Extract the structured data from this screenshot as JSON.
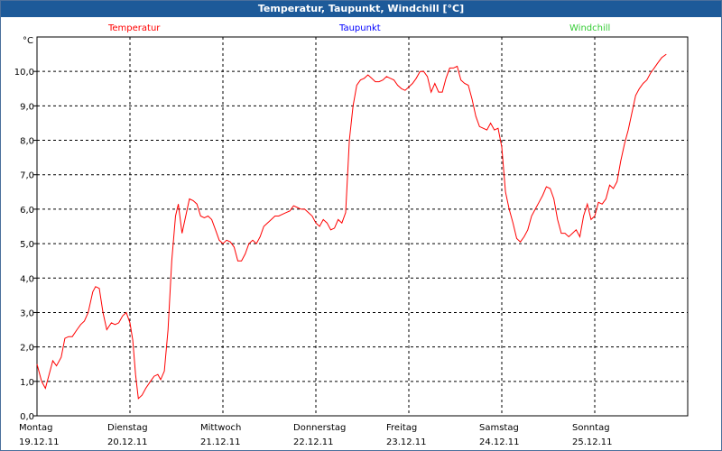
{
  "window": {
    "title": "Temperatur, Taupunkt, Windchill [°C]"
  },
  "legend": [
    {
      "name": "Temperatur",
      "color": "#ff0000"
    },
    {
      "name": "Taupunkt",
      "color": "#0000ff"
    },
    {
      "name": "Windchill",
      "color": "#33cc33"
    }
  ],
  "chart_data": {
    "type": "line",
    "title": "Temperatur, Taupunkt, Windchill [°C]",
    "ylabel": "°C",
    "ylim": [
      0,
      11
    ],
    "xlim": [
      0,
      7
    ],
    "grid": true,
    "legend_position": "top",
    "y_ticks": [
      {
        "value": 0,
        "label": "0,0"
      },
      {
        "value": 1,
        "label": "1,0"
      },
      {
        "value": 2,
        "label": "2,0"
      },
      {
        "value": 3,
        "label": "3,0"
      },
      {
        "value": 4,
        "label": "4,0"
      },
      {
        "value": 5,
        "label": "5,0"
      },
      {
        "value": 6,
        "label": "6,0"
      },
      {
        "value": 7,
        "label": "7,0"
      },
      {
        "value": 8,
        "label": "8,0"
      },
      {
        "value": 9,
        "label": "9,0"
      },
      {
        "value": 10,
        "label": "10,0"
      }
    ],
    "x_ticks": [
      {
        "value": 0,
        "day": "Montag",
        "date": "19.12.11"
      },
      {
        "value": 1,
        "day": "Dienstag",
        "date": "20.12.11"
      },
      {
        "value": 2,
        "day": "Mittwoch",
        "date": "21.12.11"
      },
      {
        "value": 3,
        "day": "Donnerstag",
        "date": "22.12.11"
      },
      {
        "value": 4,
        "day": "Freitag",
        "date": "23.12.11"
      },
      {
        "value": 5,
        "day": "Samstag",
        "date": "24.12.11"
      },
      {
        "value": 6,
        "day": "Sonntag",
        "date": "25.12.11"
      }
    ],
    "series": [
      {
        "name": "Temperatur",
        "color": "#ff0000",
        "points": [
          [
            0.0,
            1.5
          ],
          [
            0.05,
            1.0
          ],
          [
            0.09,
            0.8
          ],
          [
            0.13,
            1.2
          ],
          [
            0.17,
            1.6
          ],
          [
            0.21,
            1.45
          ],
          [
            0.26,
            1.7
          ],
          [
            0.3,
            2.25
          ],
          [
            0.34,
            2.3
          ],
          [
            0.38,
            2.3
          ],
          [
            0.43,
            2.5
          ],
          [
            0.47,
            2.65
          ],
          [
            0.51,
            2.75
          ],
          [
            0.55,
            3.0
          ],
          [
            0.6,
            3.6
          ],
          [
            0.63,
            3.75
          ],
          [
            0.67,
            3.7
          ],
          [
            0.71,
            3.0
          ],
          [
            0.75,
            2.5
          ],
          [
            0.8,
            2.7
          ],
          [
            0.84,
            2.65
          ],
          [
            0.88,
            2.7
          ],
          [
            0.92,
            2.9
          ],
          [
            0.96,
            3.0
          ],
          [
            1.0,
            2.7
          ],
          [
            1.03,
            2.2
          ],
          [
            1.06,
            1.2
          ],
          [
            1.09,
            0.5
          ],
          [
            1.13,
            0.6
          ],
          [
            1.17,
            0.8
          ],
          [
            1.22,
            1.0
          ],
          [
            1.26,
            1.15
          ],
          [
            1.3,
            1.2
          ],
          [
            1.33,
            1.05
          ],
          [
            1.37,
            1.3
          ],
          [
            1.41,
            2.5
          ],
          [
            1.45,
            4.5
          ],
          [
            1.49,
            5.8
          ],
          [
            1.52,
            6.15
          ],
          [
            1.56,
            5.3
          ],
          [
            1.6,
            5.8
          ],
          [
            1.64,
            6.3
          ],
          [
            1.68,
            6.25
          ],
          [
            1.72,
            6.15
          ],
          [
            1.76,
            5.8
          ],
          [
            1.8,
            5.75
          ],
          [
            1.84,
            5.8
          ],
          [
            1.88,
            5.7
          ],
          [
            1.92,
            5.4
          ],
          [
            1.96,
            5.1
          ],
          [
            2.0,
            5.0
          ],
          [
            2.04,
            5.1
          ],
          [
            2.08,
            5.05
          ],
          [
            2.12,
            4.9
          ],
          [
            2.16,
            4.5
          ],
          [
            2.2,
            4.5
          ],
          [
            2.24,
            4.7
          ],
          [
            2.28,
            5.0
          ],
          [
            2.32,
            5.1
          ],
          [
            2.36,
            5.0
          ],
          [
            2.4,
            5.2
          ],
          [
            2.44,
            5.5
          ],
          [
            2.48,
            5.6
          ],
          [
            2.52,
            5.7
          ],
          [
            2.56,
            5.8
          ],
          [
            2.6,
            5.8
          ],
          [
            2.64,
            5.85
          ],
          [
            2.68,
            5.9
          ],
          [
            2.72,
            5.95
          ],
          [
            2.76,
            6.1
          ],
          [
            2.8,
            6.05
          ],
          [
            2.84,
            6.0
          ],
          [
            2.88,
            6.0
          ],
          [
            2.92,
            5.9
          ],
          [
            2.96,
            5.8
          ],
          [
            3.0,
            5.6
          ],
          [
            3.04,
            5.5
          ],
          [
            3.08,
            5.7
          ],
          [
            3.12,
            5.6
          ],
          [
            3.16,
            5.4
          ],
          [
            3.2,
            5.45
          ],
          [
            3.24,
            5.7
          ],
          [
            3.28,
            5.6
          ],
          [
            3.32,
            5.9
          ],
          [
            3.36,
            8.0
          ],
          [
            3.4,
            9.0
          ],
          [
            3.44,
            9.6
          ],
          [
            3.48,
            9.75
          ],
          [
            3.52,
            9.8
          ],
          [
            3.56,
            9.9
          ],
          [
            3.6,
            9.8
          ],
          [
            3.64,
            9.7
          ],
          [
            3.68,
            9.7
          ],
          [
            3.72,
            9.75
          ],
          [
            3.76,
            9.85
          ],
          [
            3.8,
            9.8
          ],
          [
            3.84,
            9.75
          ],
          [
            3.88,
            9.6
          ],
          [
            3.92,
            9.5
          ],
          [
            3.96,
            9.45
          ],
          [
            4.0,
            9.55
          ],
          [
            4.04,
            9.65
          ],
          [
            4.08,
            9.8
          ],
          [
            4.12,
            10.0
          ],
          [
            4.16,
            10.0
          ],
          [
            4.2,
            9.85
          ],
          [
            4.24,
            9.4
          ],
          [
            4.28,
            9.65
          ],
          [
            4.32,
            9.4
          ],
          [
            4.36,
            9.4
          ],
          [
            4.4,
            9.8
          ],
          [
            4.44,
            10.1
          ],
          [
            4.48,
            10.1
          ],
          [
            4.52,
            10.15
          ],
          [
            4.56,
            9.75
          ],
          [
            4.6,
            9.65
          ],
          [
            4.64,
            9.6
          ],
          [
            4.68,
            9.2
          ],
          [
            4.72,
            8.7
          ],
          [
            4.76,
            8.4
          ],
          [
            4.8,
            8.35
          ],
          [
            4.84,
            8.3
          ],
          [
            4.88,
            8.5
          ],
          [
            4.92,
            8.3
          ],
          [
            4.96,
            8.35
          ],
          [
            5.0,
            7.8
          ],
          [
            5.04,
            6.5
          ],
          [
            5.08,
            6.0
          ],
          [
            5.12,
            5.6
          ],
          [
            5.16,
            5.15
          ],
          [
            5.2,
            5.05
          ],
          [
            5.24,
            5.2
          ],
          [
            5.28,
            5.4
          ],
          [
            5.32,
            5.8
          ],
          [
            5.36,
            6.0
          ],
          [
            5.4,
            6.2
          ],
          [
            5.44,
            6.4
          ],
          [
            5.48,
            6.65
          ],
          [
            5.52,
            6.6
          ],
          [
            5.56,
            6.3
          ],
          [
            5.6,
            5.7
          ],
          [
            5.64,
            5.3
          ],
          [
            5.68,
            5.3
          ],
          [
            5.72,
            5.2
          ],
          [
            5.76,
            5.3
          ],
          [
            5.8,
            5.4
          ],
          [
            5.84,
            5.2
          ],
          [
            5.88,
            5.8
          ],
          [
            5.92,
            6.15
          ],
          [
            5.96,
            5.7
          ],
          [
            6.0,
            5.8
          ],
          [
            6.04,
            6.2
          ],
          [
            6.08,
            6.15
          ],
          [
            6.12,
            6.3
          ],
          [
            6.16,
            6.7
          ],
          [
            6.2,
            6.6
          ],
          [
            6.24,
            6.8
          ],
          [
            6.28,
            7.4
          ],
          [
            6.32,
            7.9
          ],
          [
            6.36,
            8.3
          ],
          [
            6.4,
            8.8
          ],
          [
            6.44,
            9.3
          ],
          [
            6.48,
            9.5
          ],
          [
            6.52,
            9.65
          ],
          [
            6.56,
            9.75
          ],
          [
            6.6,
            9.95
          ],
          [
            6.64,
            10.1
          ],
          [
            6.68,
            10.25
          ],
          [
            6.72,
            10.4
          ],
          [
            6.77,
            10.5
          ]
        ]
      }
    ]
  }
}
